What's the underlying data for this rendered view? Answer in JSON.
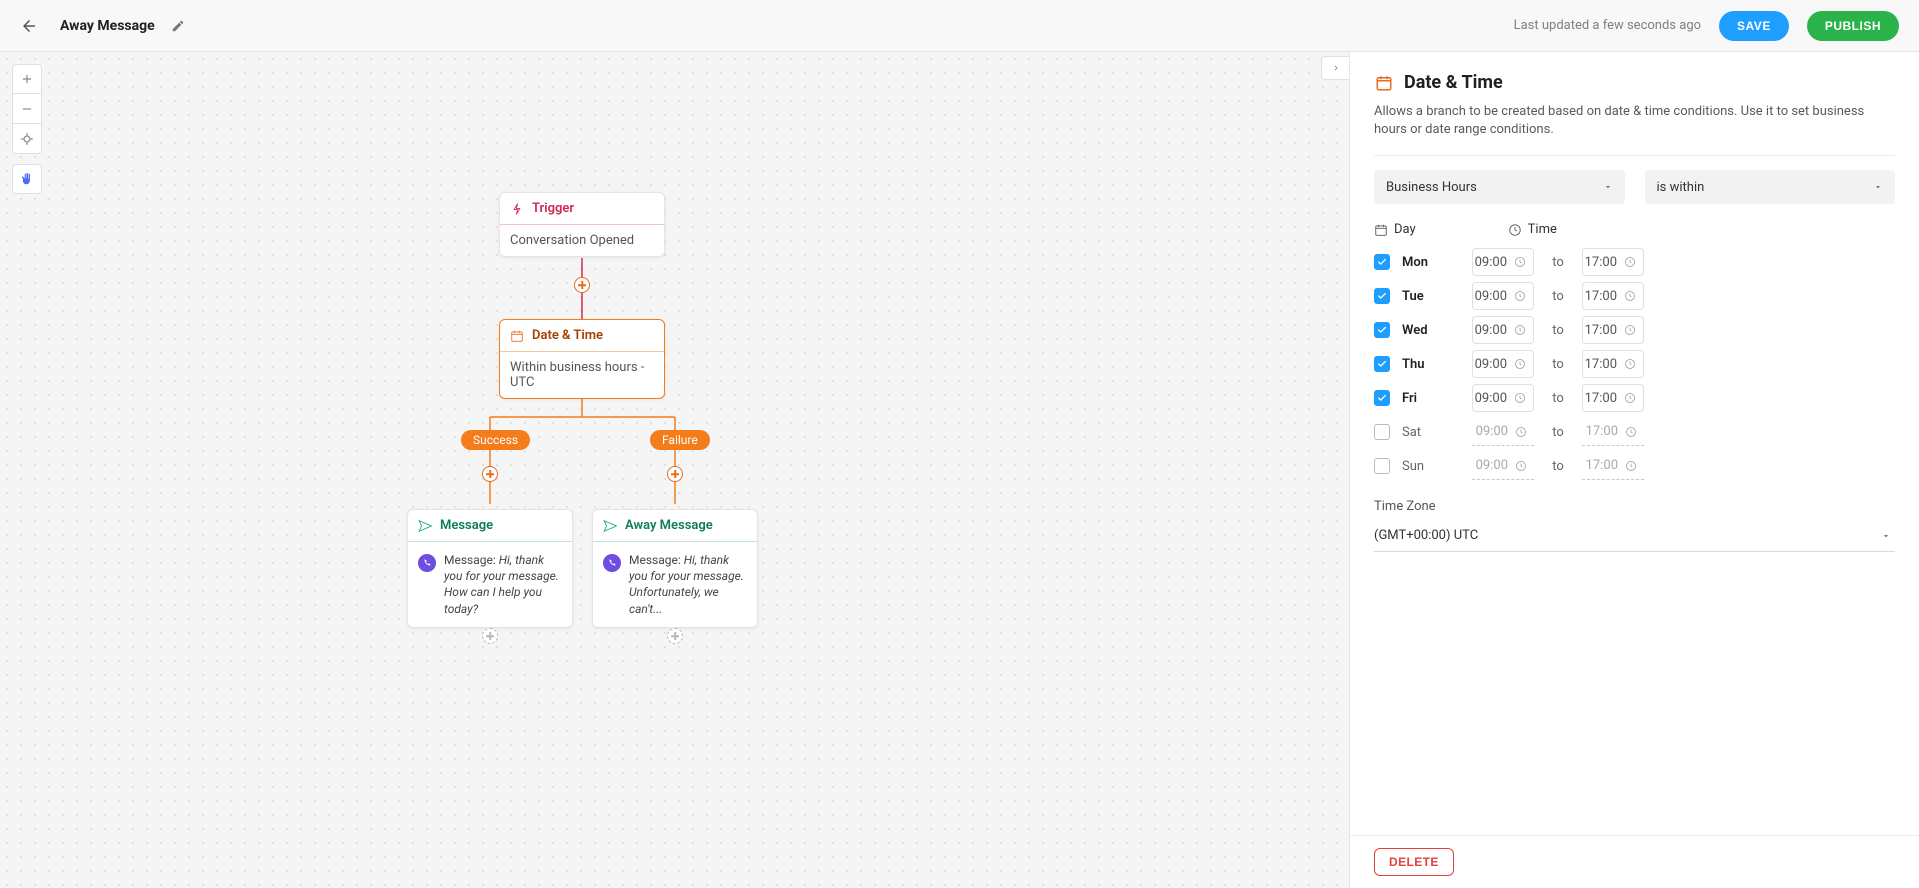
{
  "header": {
    "page_title": "Away Message",
    "last_updated": "Last updated a few seconds ago",
    "save_label": "SAVE",
    "publish_label": "PUBLISH"
  },
  "canvas": {
    "trigger": {
      "title": "Trigger",
      "body": "Conversation Opened"
    },
    "datetime_node": {
      "title": "Date & Time",
      "body": "Within business hours - UTC"
    },
    "branches": {
      "success_label": "Success",
      "failure_label": "Failure"
    },
    "message_success": {
      "title": "Message",
      "prefix": "Message: ",
      "body": "Hi, thank you for your message. How can I help you today?"
    },
    "message_failure": {
      "title": "Away Message",
      "prefix": "Message: ",
      "body": "Hi, thank you for your message. Unfortunately, we can't..."
    }
  },
  "panel": {
    "title": "Date & Time",
    "description": "Allows a branch to be created based on date & time conditions. Use it to set business hours or date range conditions.",
    "mode_select": "Business Hours",
    "op_select": "is within",
    "column_day": "Day",
    "column_time": "Time",
    "to_label": "to",
    "days": [
      {
        "name": "Mon",
        "enabled": true,
        "start": "09:00",
        "end": "17:00"
      },
      {
        "name": "Tue",
        "enabled": true,
        "start": "09:00",
        "end": "17:00"
      },
      {
        "name": "Wed",
        "enabled": true,
        "start": "09:00",
        "end": "17:00"
      },
      {
        "name": "Thu",
        "enabled": true,
        "start": "09:00",
        "end": "17:00"
      },
      {
        "name": "Fri",
        "enabled": true,
        "start": "09:00",
        "end": "17:00"
      },
      {
        "name": "Sat",
        "enabled": false,
        "start": "09:00",
        "end": "17:00"
      },
      {
        "name": "Sun",
        "enabled": false,
        "start": "09:00",
        "end": "17:00"
      }
    ],
    "timezone_label": "Time Zone",
    "timezone_value": "(GMT+00:00) UTC",
    "delete_label": "DELETE"
  },
  "colors": {
    "accent_orange": "#f57c1b",
    "accent_blue": "#1e9eff",
    "accent_green": "#2bb34b",
    "accent_red": "#e34040"
  }
}
